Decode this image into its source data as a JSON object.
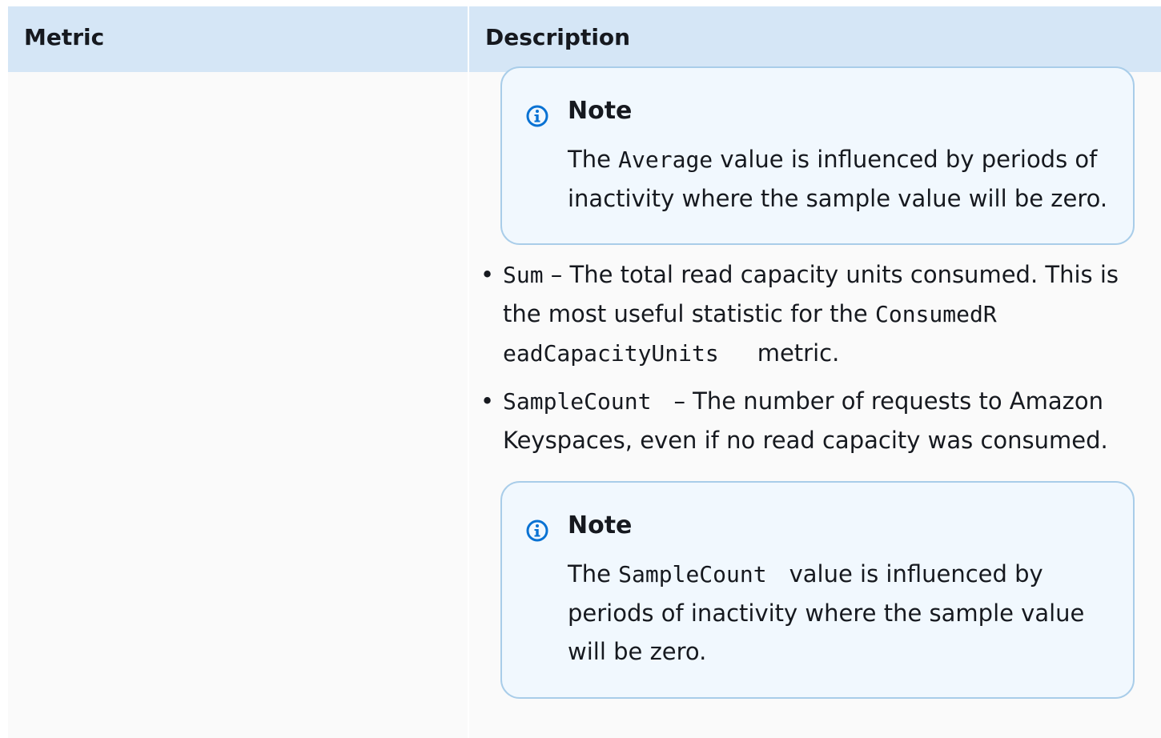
{
  "table": {
    "headers": {
      "metric": "Metric",
      "description": "Description"
    }
  },
  "note1": {
    "title": "Note",
    "text_before": "The ",
    "code": "Average",
    "text_after": " value is influenced by periods of inactivity where the sample value will be zero."
  },
  "bullets": [
    {
      "code": "Sum",
      "text": " – The total read capacity units consumed. This is the most useful statistic for the ",
      "code2_line1": "ConsumedR",
      "code2_line2": "eadCapacityUnits",
      "text2": "metric."
    },
    {
      "code": "SampleCount",
      "text": "– The number of requests to Amazon Keyspaces, even if no read capacity was consumed."
    }
  ],
  "note2": {
    "title": "Note",
    "text_before": "The ",
    "code": "SampleCount",
    "text_after": "value is influenced by periods of inactivity where the sample value will be zero."
  },
  "icons": {
    "note_icon": "info-circle-icon"
  },
  "colors": {
    "header_bg": "#d5e6f6",
    "note_bg": "#f1f8fe",
    "note_border": "#a9cde9",
    "icon": "#0972d3"
  }
}
